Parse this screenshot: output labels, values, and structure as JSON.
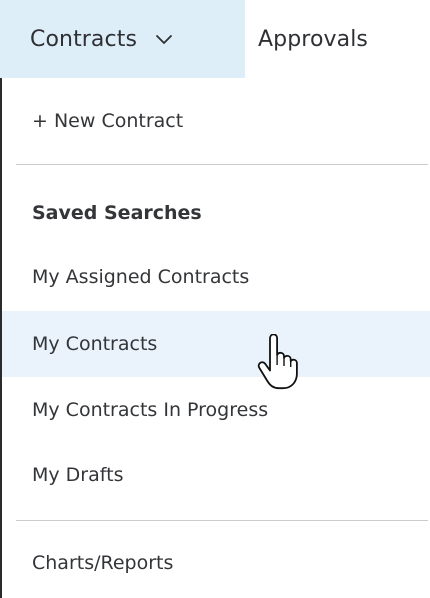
{
  "topnav": {
    "tabs": [
      {
        "label": "Contracts",
        "active": true,
        "has_dropdown": true
      },
      {
        "label": "Approvals",
        "active": false
      }
    ]
  },
  "menu": {
    "new_contract": "+ New Contract",
    "saved_searches_heading": "Saved Searches",
    "items": [
      {
        "label": "My Assigned Contracts"
      },
      {
        "label": "My Contracts",
        "hovered": true
      },
      {
        "label": "My Contracts In Progress"
      },
      {
        "label": "My Drafts"
      }
    ],
    "charts_reports": "Charts/Reports"
  },
  "colors": {
    "active_tab_bg": "#deeef9",
    "hover_item_bg": "#eaf3fb",
    "text": "#333538",
    "divider": "#c9cbcd"
  },
  "cursor": "hand-pointer-icon"
}
